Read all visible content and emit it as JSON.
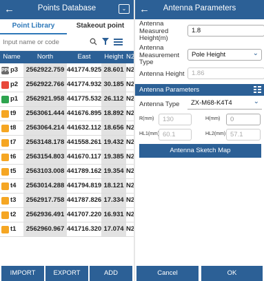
{
  "left": {
    "title": "Points Database",
    "back_icon": "←",
    "dropdown_icon": "⌄",
    "tabs": [
      "Point Library",
      "Stakeout point"
    ],
    "search_placeholder": "Input name or code",
    "columns": [
      "Name",
      "North",
      "East",
      "Height",
      "N2"
    ],
    "rows": [
      {
        "icon": "gray",
        "icon_text": "PPK",
        "name": "p3",
        "north": "2562922.759",
        "east": "441774.925",
        "height": "28.601",
        "code": "N2"
      },
      {
        "icon": "red",
        "icon_text": "",
        "name": "p2",
        "north": "2562922.766",
        "east": "441774.932",
        "height": "30.185",
        "code": "N2"
      },
      {
        "icon": "green",
        "icon_text": "",
        "name": "p1",
        "north": "2562921.958",
        "east": "441775.532",
        "height": "26.112",
        "code": "N2"
      },
      {
        "icon": "orange",
        "icon_text": "",
        "name": "t9",
        "north": "2563061.444",
        "east": "441676.895",
        "height": "18.892",
        "code": "N2"
      },
      {
        "icon": "orange",
        "icon_text": "",
        "name": "t8",
        "north": "2563064.214",
        "east": "441632.112",
        "height": "18.656",
        "code": "N2"
      },
      {
        "icon": "orange",
        "icon_text": "",
        "name": "t7",
        "north": "2563148.178",
        "east": "441558.261",
        "height": "19.432",
        "code": "N2"
      },
      {
        "icon": "orange",
        "icon_text": "",
        "name": "t6",
        "north": "2563154.803",
        "east": "441670.117",
        "height": "19.385",
        "code": "N2"
      },
      {
        "icon": "orange",
        "icon_text": "",
        "name": "t5",
        "north": "2563103.008",
        "east": "441789.162",
        "height": "19.354",
        "code": "N2"
      },
      {
        "icon": "orange",
        "icon_text": "",
        "name": "t4",
        "north": "2563014.288",
        "east": "441794.819",
        "height": "18.121",
        "code": "N2"
      },
      {
        "icon": "orange",
        "icon_text": "",
        "name": "t3",
        "north": "2562917.758",
        "east": "441787.826",
        "height": "17.334",
        "code": "N2"
      },
      {
        "icon": "orange",
        "icon_text": "",
        "name": "t2",
        "north": "2562936.491",
        "east": "441707.220",
        "height": "16.931",
        "code": "N2"
      },
      {
        "icon": "orange",
        "icon_text": "",
        "name": "t1",
        "north": "2562960.967",
        "east": "441716.320",
        "height": "17.074",
        "code": "N2"
      }
    ],
    "buttons": {
      "import": "IMPORT",
      "export": "EXPORT",
      "add": "ADD"
    }
  },
  "right": {
    "title": "Antenna Parameters",
    "back_icon": "←",
    "measured_height_label": "Antenna Measured Height(m)",
    "measured_height_value": "1.8",
    "measurement_type_label": "Antenna Measurement Type",
    "measurement_type_value": "Pole Height",
    "antenna_height_label": "Antenna Height",
    "antenna_height_value": "1.86",
    "section_title": "Antenna Parameters",
    "antenna_type_label": "Antenna Type",
    "antenna_type_value": "ZX-M68-K4T4",
    "r_label": "R(mm)",
    "r_value": "130",
    "h_label": "H(mm)",
    "h_value": "0",
    "hl1_label": "HL1(mm)",
    "hl1_value": "60.1",
    "hl2_label": "HL2(mm)",
    "hl2_value": "57.1",
    "sketch_button": "Antenna Sketch Map",
    "cancel": "Cancel",
    "ok": "OK"
  },
  "colors": {
    "primary": "#2c6096",
    "accent": "#2c77b8",
    "point_orange": "#f5a623",
    "point_red": "#e8483a",
    "point_green": "#2ea44f"
  }
}
